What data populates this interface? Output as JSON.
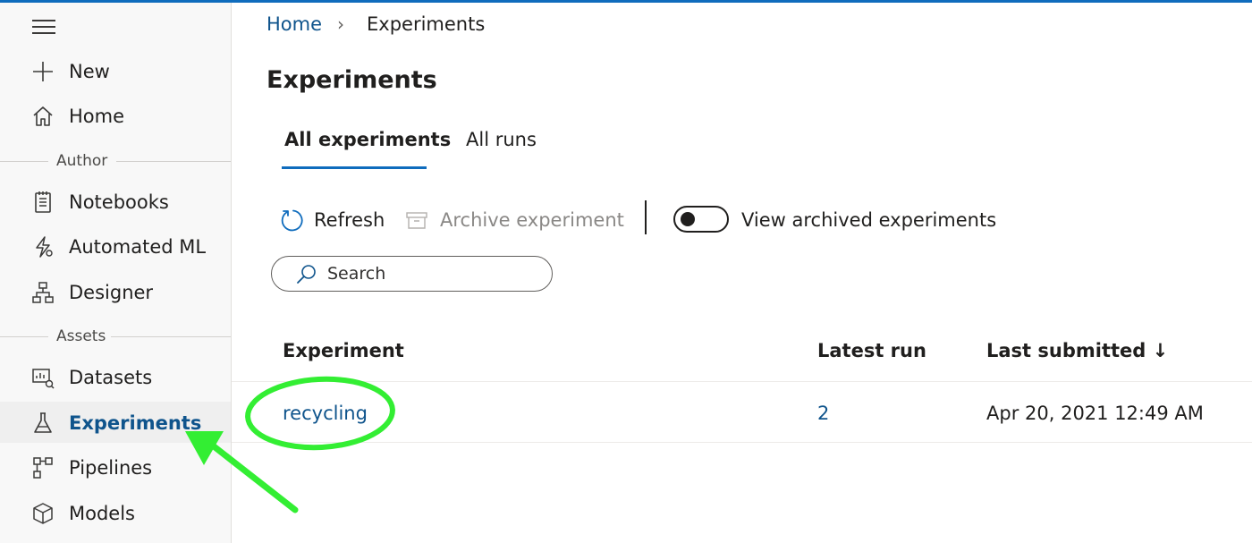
{
  "sidebar": {
    "items": [
      {
        "label": "New",
        "icon": "plus-icon"
      },
      {
        "label": "Home",
        "icon": "home-icon"
      },
      {
        "label": "Notebooks",
        "icon": "notebook-icon"
      },
      {
        "label": "Automated ML",
        "icon": "automated-ml-icon"
      },
      {
        "label": "Designer",
        "icon": "designer-icon"
      },
      {
        "label": "Datasets",
        "icon": "datasets-icon"
      },
      {
        "label": "Experiments",
        "icon": "flask-icon",
        "active": true
      },
      {
        "label": "Pipelines",
        "icon": "pipelines-icon"
      },
      {
        "label": "Models",
        "icon": "cube-icon"
      }
    ],
    "sections": {
      "author": "Author",
      "assets": "Assets"
    }
  },
  "breadcrumb": {
    "home": "Home",
    "current": "Experiments"
  },
  "page": {
    "title": "Experiments"
  },
  "tabs": [
    {
      "label": "All experiments",
      "active": true
    },
    {
      "label": "All runs",
      "active": false
    }
  ],
  "toolbar": {
    "refresh": "Refresh",
    "archive": "Archive experiment",
    "view_archived": "View archived experiments",
    "view_archived_on": false
  },
  "search": {
    "placeholder": "Search"
  },
  "table": {
    "columns": [
      "Experiment",
      "Latest run",
      "Last submitted"
    ],
    "sort_indicator": "↓",
    "rows": [
      {
        "experiment": "recycling",
        "latest_run": "2",
        "last_submitted": "Apr 20, 2021 12:49 AM"
      }
    ]
  },
  "colors": {
    "accent": "#0f6cbd",
    "link": "#0f548c",
    "annotation": "#33ee33"
  }
}
